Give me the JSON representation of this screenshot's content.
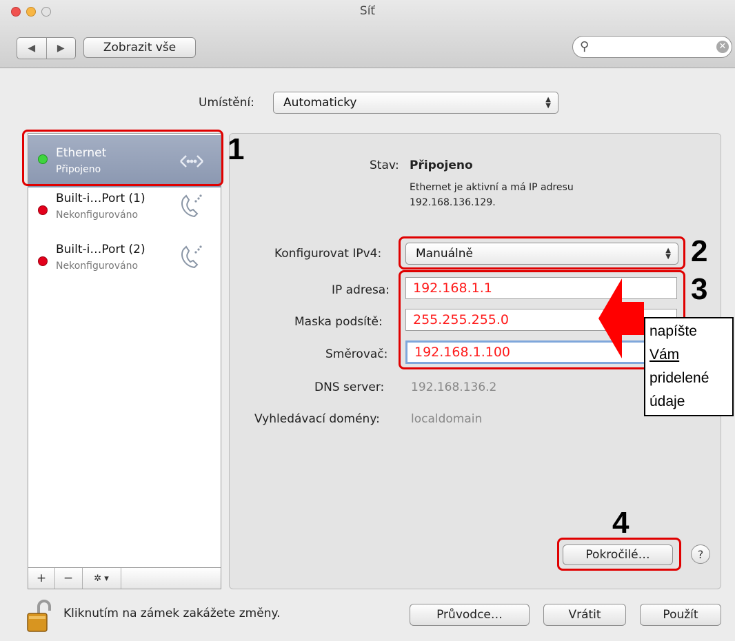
{
  "window": {
    "title": "Síť"
  },
  "toolbar": {
    "back_glyph": "◀",
    "forward_glyph": "▶",
    "show_all": "Zobrazit vše",
    "search_glyph": "⚲",
    "search_clear": "✕"
  },
  "location": {
    "label": "Umístění:",
    "value": "Automaticky"
  },
  "services": [
    {
      "name": "Ethernet",
      "status": "Připojeno",
      "color": "#3fd43f",
      "selected": true
    },
    {
      "name": "Built-i…Port (1)",
      "status": "Nekonfigurováno",
      "color": "#e3001b",
      "selected": false
    },
    {
      "name": "Built-i…Port (2)",
      "status": "Nekonfigurováno",
      "color": "#e3001b",
      "selected": false
    }
  ],
  "sidebar_footer": {
    "add": "+",
    "remove": "−",
    "gear": "✲ ▾"
  },
  "detail": {
    "status_label": "Stav:",
    "status_value": "Připojeno",
    "status_desc_line1": "Ethernet je aktivní a má IP adresu",
    "status_desc_line2": "192.168.136.129.",
    "ipv4_label": "Konfigurovat IPv4:",
    "ipv4_value": "Manuálně",
    "ip_label": "IP adresa:",
    "ip_value": "192.168.1.1",
    "mask_label": "Maska podsítě:",
    "mask_value": "255.255.255.0",
    "router_label": "Směrovač:",
    "router_value": "192.168.1.100",
    "dns_label": "DNS server:",
    "dns_value": "192.168.136.2",
    "domains_label": "Vyhledávací domény:",
    "domains_value": "localdomain",
    "advanced": "Pokročilé…",
    "help": "?"
  },
  "annotations": {
    "n1": "1",
    "n2": "2",
    "n3": "3",
    "n4": "4",
    "note": [
      "napíšte",
      "Vám",
      "pridelené",
      "údaje"
    ]
  },
  "footer": {
    "lock_text": "Kliknutím na zámek zakážete změny.",
    "assistant": "Průvodce…",
    "revert": "Vrátit",
    "apply": "Použít"
  },
  "colors": {
    "accent_red": "#e00000",
    "field_text": "#ff1a1a",
    "selection": "#8a97b0"
  }
}
